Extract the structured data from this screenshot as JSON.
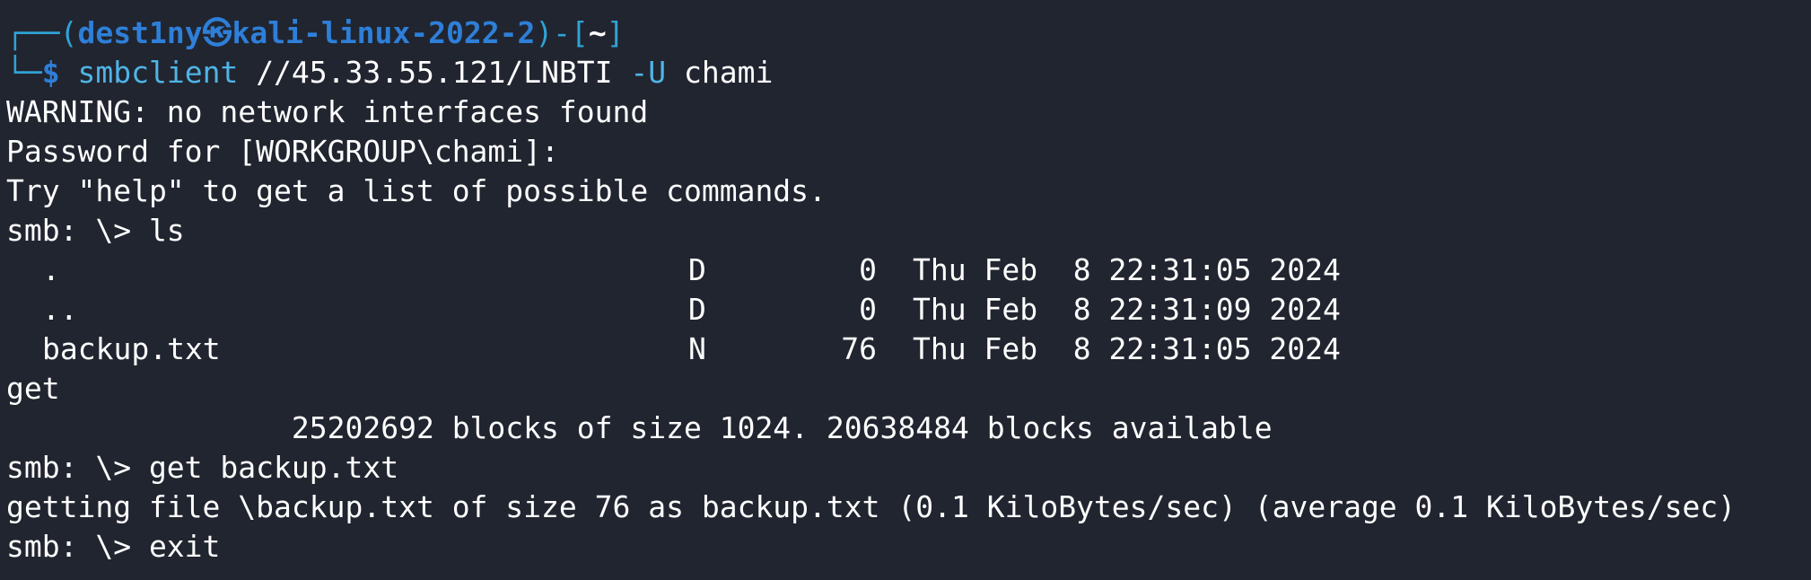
{
  "prompt": {
    "frame_top_left": "┌──(",
    "user": "dest1ny㉿kali-linux-2022-2",
    "frame_mid": ")-[",
    "cwd": "~",
    "frame_close": "]",
    "frame_bottom": "└─",
    "dollar": "$",
    "command": "smbclient",
    "target": "//45.33.55.121/LNBTI",
    "flag": "-U",
    "flag_value": "chami"
  },
  "lines": {
    "warning": "WARNING: no network interfaces found",
    "password": "Password for [WORKGROUP\\chami]:",
    "help_hint": "Try \"help\" to get a list of possible commands.",
    "smb_ls": "smb: \\> ls",
    "get": "get",
    "blocks": "                25202692 blocks of size 1024. 20638484 blocks available",
    "smb_get": "smb: \\> get backup.txt",
    "getting": "getting file \\backup.txt of size 76 as backup.txt (0.1 KiloBytes/sec) (average 0.1 KiloBytes/sec)",
    "smb_exit": "smb: \\> exit"
  },
  "listing": [
    {
      "name": ".",
      "type": "D",
      "size": "0",
      "date": "Thu Feb  8 22:31:05 2024"
    },
    {
      "name": "..",
      "type": "D",
      "size": "0",
      "date": "Thu Feb  8 22:31:09 2024"
    },
    {
      "name": "backup.txt",
      "type": "N",
      "size": "76",
      "date": "Thu Feb  8 22:31:05 2024"
    }
  ],
  "colors": {
    "background": "#212530",
    "prompt_frame": "#2fa3d6",
    "prompt_user": "#2e7fd8",
    "command": "#4fb4e6",
    "text": "#ffffff"
  }
}
